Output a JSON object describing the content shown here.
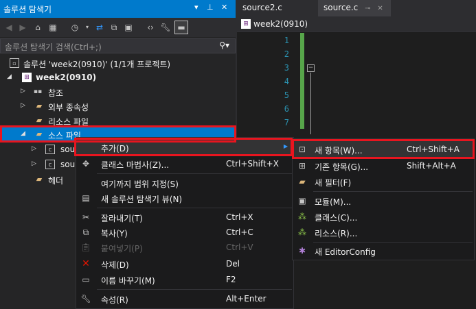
{
  "solution_explorer": {
    "title": "솔루션 탐색기",
    "search_placeholder": "솔루션 탐색기 검색(Ctrl+;)",
    "tree": [
      {
        "label": "솔루션 'week2(0910)' (1/1개 프로젝트)",
        "icon": "solution-icon"
      },
      {
        "label": "week2(0910)",
        "icon": "project-icon"
      },
      {
        "label": "참조",
        "icon": "references-icon"
      },
      {
        "label": "외부 종속성",
        "icon": "folder-icon"
      },
      {
        "label": "리소스 파일",
        "icon": "folder-icon"
      },
      {
        "label": "소스 파일",
        "icon": "folder-icon"
      },
      {
        "label": "sou",
        "icon": "cpp-file-icon"
      },
      {
        "label": "sou",
        "icon": "cpp-file-icon"
      },
      {
        "label": "헤더",
        "icon": "folder-icon"
      }
    ]
  },
  "editor": {
    "tabs": [
      {
        "label": "source2.c"
      },
      {
        "label": "source.c"
      }
    ],
    "file_nav": "week2(0910)",
    "line_numbers": [
      "1",
      "2",
      "3",
      "4",
      "5",
      "6",
      "7"
    ]
  },
  "context_menu": {
    "items": [
      {
        "label": "추가(D)",
        "shortcut": "",
        "icon": ""
      },
      {
        "label": "클래스 마법사(Z)...",
        "shortcut": "Ctrl+Shift+X",
        "icon": "class-wizard-icon"
      },
      {
        "label": "여기까지 범위 지정(S)",
        "shortcut": "",
        "icon": ""
      },
      {
        "label": "새 솔루션 탐색기 뷰(N)",
        "shortcut": "",
        "icon": "new-view-icon"
      },
      {
        "label": "잘라내기(T)",
        "shortcut": "Ctrl+X",
        "icon": "cut-icon"
      },
      {
        "label": "복사(Y)",
        "shortcut": "Ctrl+C",
        "icon": "copy-icon"
      },
      {
        "label": "붙여넣기(P)",
        "shortcut": "Ctrl+V",
        "icon": "paste-icon"
      },
      {
        "label": "삭제(D)",
        "shortcut": "Del",
        "icon": "delete-icon"
      },
      {
        "label": "이름 바꾸기(M)",
        "shortcut": "F2",
        "icon": "rename-icon"
      },
      {
        "label": "속성(R)",
        "shortcut": "Alt+Enter",
        "icon": "properties-icon"
      }
    ]
  },
  "submenu": {
    "items": [
      {
        "label": "새 항목(W)...",
        "shortcut": "Ctrl+Shift+A",
        "icon": "new-item-icon"
      },
      {
        "label": "기존 항목(G)...",
        "shortcut": "Shift+Alt+A",
        "icon": "existing-item-icon"
      },
      {
        "label": "새 필터(F)",
        "shortcut": "",
        "icon": "new-filter-icon"
      },
      {
        "label": "모듈(M)...",
        "shortcut": "",
        "icon": "module-icon"
      },
      {
        "label": "클래스(C)...",
        "shortcut": "",
        "icon": "class-icon"
      },
      {
        "label": "리소스(R)...",
        "shortcut": "",
        "icon": "resource-icon"
      },
      {
        "label": "새 EditorConfig",
        "shortcut": "",
        "icon": "editorconfig-icon"
      }
    ]
  },
  "colors": {
    "accent": "#007acc",
    "highlight_box": "#e8151f",
    "line_numbers": "#2b91af",
    "change_bar": "#57a64a"
  }
}
